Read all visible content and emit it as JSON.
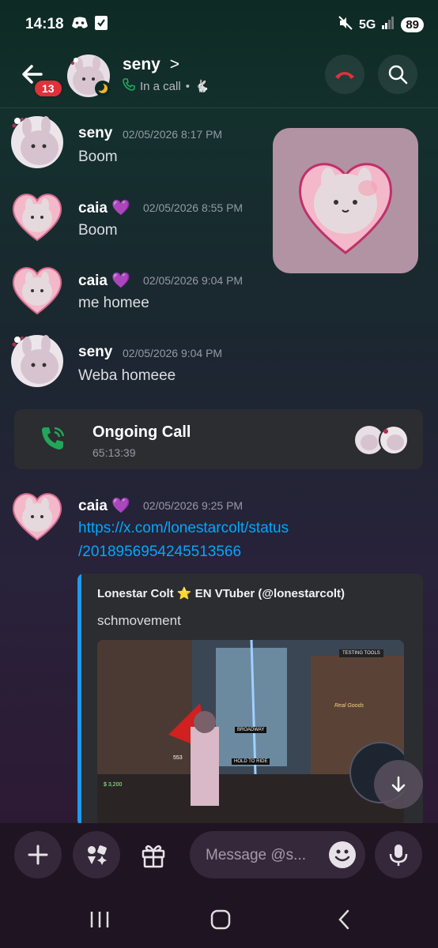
{
  "status_bar": {
    "time": "14:18",
    "network": "5G",
    "battery": "89"
  },
  "header": {
    "unread_badge": "13",
    "name": "seny",
    "chevron": ">",
    "status": "In a call",
    "status_separator": "•",
    "status_emoji": "🐇"
  },
  "messages": [
    {
      "author": "seny",
      "timestamp": "02/05/2026 8:17 PM",
      "text": "Boom"
    },
    {
      "author": "caia 💜",
      "timestamp": "02/05/2026 8:55 PM",
      "text": "Boom"
    },
    {
      "author": "caia 💜",
      "timestamp": "02/05/2026 9:04 PM",
      "text": "me homee"
    },
    {
      "author": "seny",
      "timestamp": "02/05/2026 9:04 PM",
      "text": "Weba homeee"
    },
    {
      "author": "caia 💜",
      "timestamp": "02/05/2026 9:25 PM",
      "link_line1": "https://x.com/lonestarcolt/status",
      "link_line2": "/2018956954245513566"
    }
  ],
  "call": {
    "title": "Ongoing Call",
    "duration": "65:13:39"
  },
  "embed": {
    "author": "Lonestar Colt ⭐ EN VTuber (@lonestarcolt)",
    "description": "schmovement",
    "hud": {
      "testing_tools": "TESTING TOOLS",
      "sign": "BROADWAY",
      "hint": "HOLD  TO RIDE",
      "money": "$ 3,200",
      "speed": "553",
      "shop": "Real Goods"
    }
  },
  "composer": {
    "placeholder": "Message @s..."
  },
  "colors": {
    "link": "#00a8fc",
    "hangup": "#e0313b",
    "call_green": "#23a55a",
    "embed_bar": "#1d9bf0"
  }
}
